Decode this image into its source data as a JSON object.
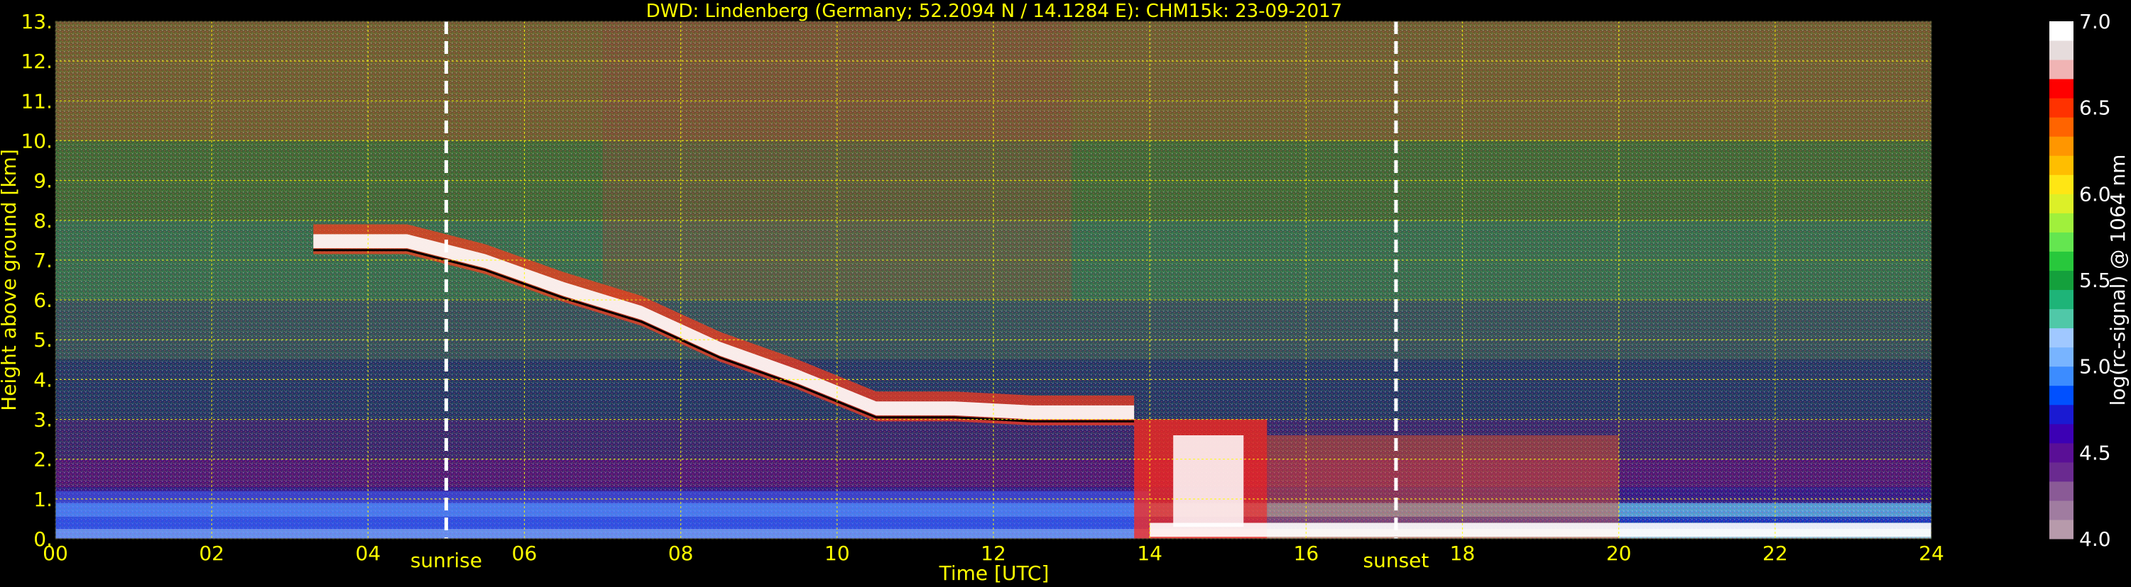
{
  "chart_data": {
    "type": "heatmap",
    "title": "DWD: Lindenberg (Germany; 52.2094 N / 14.1284 E):    CHM15k: 23-09-2017",
    "xlabel": "Time [UTC]",
    "ylabel": "Height above ground [km]",
    "xlim": [
      0,
      24
    ],
    "ylim": [
      0,
      13
    ],
    "x_ticks": [
      "00",
      "02",
      "04",
      "06",
      "08",
      "10",
      "12",
      "14",
      "16",
      "18",
      "20",
      "22",
      "24"
    ],
    "x_tick_values": [
      0,
      2,
      4,
      6,
      8,
      10,
      12,
      14,
      16,
      18,
      20,
      22,
      24
    ],
    "y_ticks": [
      "0.",
      "1.",
      "2.",
      "3.",
      "4.",
      "5.",
      "6.",
      "7.",
      "8.",
      "9.",
      "10.",
      "11.",
      "12.",
      "13."
    ],
    "y_tick_values": [
      0,
      1,
      2,
      3,
      4,
      5,
      6,
      7,
      8,
      9,
      10,
      11,
      12,
      13
    ],
    "grid": true,
    "colorbar": {
      "label": "log(rc-signal) @ 1064 nm",
      "range": [
        4.0,
        7.0
      ],
      "ticks": [
        "4.0",
        "4.5",
        "5.0",
        "5.5",
        "6.0",
        "6.5",
        "7.0"
      ],
      "tick_values": [
        4.0,
        4.5,
        5.0,
        5.5,
        6.0,
        6.5,
        7.0
      ],
      "colors": [
        "#b79aab",
        "#a07ca0",
        "#8a5a96",
        "#6a2a90",
        "#5a0f96",
        "#3c00b4",
        "#1a1ad2",
        "#0050ff",
        "#3c8cff",
        "#78b4ff",
        "#a0c8ff",
        "#50c8a8",
        "#1eb478",
        "#14a03c",
        "#28c83c",
        "#64e650",
        "#a0f03c",
        "#dcf028",
        "#ffe614",
        "#ffbe00",
        "#ff9600",
        "#ff6400",
        "#ff3200",
        "#ff0000",
        "#f0b4b4",
        "#e6dcdc",
        "#ffffff"
      ]
    },
    "annotations": [
      {
        "label": "sunrise",
        "x": 5.0
      },
      {
        "label": "sunset",
        "x": 17.15
      }
    ],
    "features": {
      "aerosol_layer_top_km": 1.2,
      "cirrus_base_km": [
        {
          "t": 3.3,
          "h": 7.3
        },
        {
          "t": 4.5,
          "h": 7.3
        },
        {
          "t": 5.5,
          "h": 6.8
        },
        {
          "t": 6.5,
          "h": 6.1
        },
        {
          "t": 7.5,
          "h": 5.5
        },
        {
          "t": 8.5,
          "h": 4.6
        },
        {
          "t": 9.5,
          "h": 3.9
        },
        {
          "t": 10.5,
          "h": 3.1
        },
        {
          "t": 11.5,
          "h": 3.1
        },
        {
          "t": 12.5,
          "h": 3.0
        },
        {
          "t": 13.8,
          "h": 3.0
        }
      ],
      "low_cloud_period_utc": [
        13.8,
        20.0
      ],
      "low_cloud_base_km": 0.4
    }
  }
}
